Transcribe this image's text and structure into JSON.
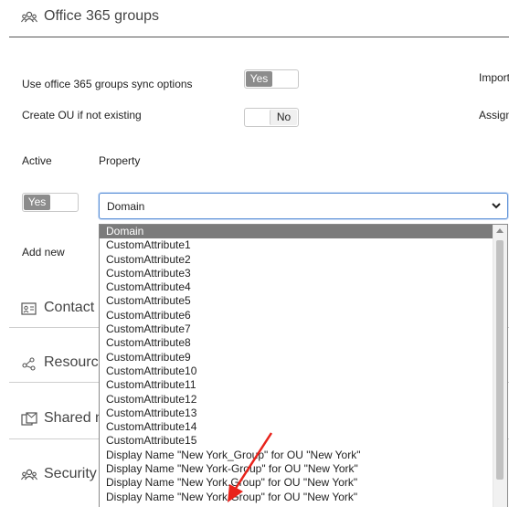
{
  "header": {
    "title": "Office 365 groups",
    "icon": "users-icon"
  },
  "right_labels": {
    "import": "Import",
    "assign": "Assign"
  },
  "settings": {
    "sync_label": "Use office 365 groups sync options",
    "sync_toggle": "Yes",
    "create_ou_label": "Create OU if not existing",
    "create_ou_toggle": "No"
  },
  "columns": {
    "active": "Active",
    "property": "Property"
  },
  "row": {
    "active_toggle": "Yes",
    "property_value": "Domain"
  },
  "add_new": "Add new",
  "sections": [
    {
      "label": "Contact",
      "icon": "contact-card-icon"
    },
    {
      "label": "Resourc",
      "icon": "share-nodes-icon"
    },
    {
      "label": "Shared m",
      "icon": "shared-mailbox-icon"
    },
    {
      "label": "Security",
      "icon": "users-icon"
    }
  ],
  "dropdown": {
    "items": [
      "Domain",
      "CustomAttribute1",
      "CustomAttribute2",
      "CustomAttribute3",
      "CustomAttribute4",
      "CustomAttribute5",
      "CustomAttribute6",
      "CustomAttribute7",
      "CustomAttribute8",
      "CustomAttribute9",
      "CustomAttribute10",
      "CustomAttribute11",
      "CustomAttribute12",
      "CustomAttribute13",
      "CustomAttribute14",
      "CustomAttribute15",
      "Display Name \"New York_Group\" for OU \"New York\"",
      "Display Name \"New York-Group\" for OU \"New York\"",
      "Display Name \"New York.Group\" for OU \"New York\"",
      "Display Name \"New York Group\" for OU \"New York\""
    ],
    "selected_index": 0
  },
  "colors": {
    "accent": "#5b8fd6",
    "selected": "#7b7b7b",
    "annotation_arrow": "#e8231b"
  }
}
